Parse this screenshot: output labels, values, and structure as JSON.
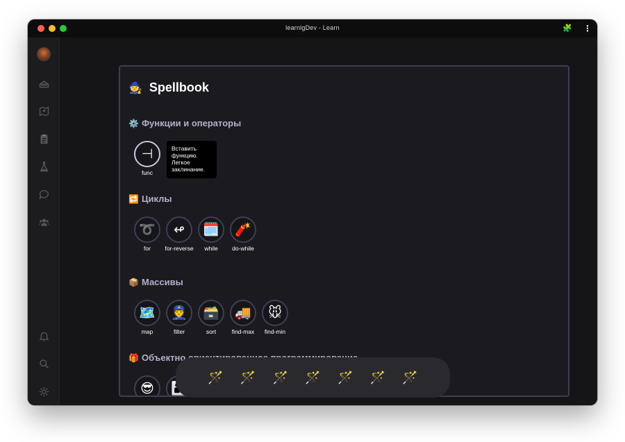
{
  "window": {
    "title": "learnlgDev - Learn"
  },
  "titlebar": {
    "extension_icon": "puzzle-icon",
    "menu_icon": "kebab-menu-icon",
    "extension_glyph": "🧩",
    "menu_glyph": "⋮"
  },
  "sidebar": {
    "items": [
      {
        "name": "sidebar-avatar",
        "icon": "avatar"
      },
      {
        "name": "sidebar-item-cake",
        "icon": "cake-icon"
      },
      {
        "name": "sidebar-item-map",
        "icon": "map-icon"
      },
      {
        "name": "sidebar-item-clipboard",
        "icon": "clipboard-icon"
      },
      {
        "name": "sidebar-item-lab",
        "icon": "flask-icon"
      },
      {
        "name": "sidebar-item-chat",
        "icon": "chat-icon"
      },
      {
        "name": "sidebar-item-users",
        "icon": "users-icon"
      },
      {
        "name": "sidebar-item-notifications",
        "icon": "bell-icon"
      },
      {
        "name": "sidebar-item-search",
        "icon": "search-icon"
      },
      {
        "name": "sidebar-item-settings",
        "icon": "gear-icon"
      }
    ]
  },
  "spellbook": {
    "title": "Spellbook",
    "title_emoji": "🧙",
    "sections": [
      {
        "emoji": "⚙️",
        "title": "Функции и операторы",
        "spells": [
          {
            "label": "func",
            "glyph": "⊣",
            "active": true
          }
        ]
      },
      {
        "emoji": "🔁",
        "title": "Циклы",
        "spells": [
          {
            "label": "for",
            "glyph": "➰"
          },
          {
            "label": "for-reverse",
            "glyph": "↫"
          },
          {
            "label": "while",
            "glyph": "🗓️"
          },
          {
            "label": "do-while",
            "glyph": "🧨"
          }
        ]
      },
      {
        "emoji": "📦",
        "title": "Массивы",
        "spells": [
          {
            "label": "map",
            "glyph": "🗺️"
          },
          {
            "label": "filter",
            "glyph": "👮"
          },
          {
            "label": "sort",
            "glyph": "🗃️"
          },
          {
            "label": "find-max",
            "glyph": "🚚"
          },
          {
            "label": "find-min",
            "glyph": "🐭"
          }
        ]
      },
      {
        "emoji": "🎁",
        "title": "Объектно ориентированное программирование",
        "spells": [
          {
            "label": "",
            "glyph": "😎"
          },
          {
            "label": "",
            "glyph": "👨‍👦"
          }
        ]
      }
    ],
    "tooltip": "Вставить функцию. Легкое заклинание."
  },
  "toolbar": {
    "slots": [
      "🪄",
      "🪄",
      "🪄",
      "🪄",
      "🪄",
      "🪄",
      "🪄"
    ]
  }
}
